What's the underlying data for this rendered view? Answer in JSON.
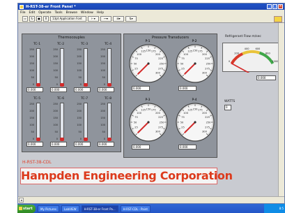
{
  "window": {
    "title": "H-RST-38-er Front Panel *",
    "menu": [
      "File",
      "Edit",
      "Operate",
      "Tools",
      "Browse",
      "Window",
      "Help"
    ],
    "toolbar": {
      "font_select": "13pt Application Font"
    }
  },
  "thermocouples": {
    "title": "Thermocouples",
    "scale": [
      "250",
      "200",
      "150",
      "100",
      "50",
      "0"
    ],
    "items": [
      {
        "label": "TC-1",
        "value": "0.000",
        "level": 0.0
      },
      {
        "label": "TC-2",
        "value": "0.000",
        "level": 0.0
      },
      {
        "label": "TC-3",
        "value": "0.000",
        "level": 0.0
      },
      {
        "label": "TC-4",
        "value": "0.000",
        "level": 0.0
      },
      {
        "label": "TC-5",
        "value": "0.000",
        "level": 0.0
      },
      {
        "label": "TC-6",
        "value": "0.000",
        "level": 0.0
      },
      {
        "label": "TC-7",
        "value": "0.000",
        "level": 0.0
      },
      {
        "label": "TC-8",
        "value": "0.000",
        "level": 0.0
      }
    ]
  },
  "pressure": {
    "title": "Pressure Transducers",
    "scale": [
      "0",
      "25",
      "50",
      "75",
      "100",
      "125",
      "150",
      "175",
      "200",
      "225",
      "250",
      "275",
      "300"
    ],
    "items": [
      {
        "label": "P-1",
        "value": "0.000",
        "reading": 0
      },
      {
        "label": "P-2",
        "value": "0.000",
        "reading": 0
      },
      {
        "label": "P-3",
        "value": "0.000",
        "reading": 0
      },
      {
        "label": "P-4",
        "value": "0.000",
        "reading": 0
      }
    ]
  },
  "refrigerant": {
    "label": "Refrigerant Flow m/sec",
    "scale": [
      "0",
      "200",
      "400",
      "600",
      "800",
      "1000"
    ],
    "value": "0.000",
    "reading": 0
  },
  "watts": {
    "label": "WATTS",
    "value": "0"
  },
  "model_label": "H-RST-38-CDL",
  "banner": "Hampden Engineering Corporation",
  "taskbar": {
    "start": "start",
    "tasks": [
      "My Pictures",
      "LabVIEW",
      "H-RST-38-er Front Pa...",
      "H-RST-CDL - Paint"
    ],
    "clock": "8:5"
  },
  "colors": {
    "accent_red": "#dc3a1c",
    "fill_blue": "#3a67c9",
    "needle_red": "#d42a2a"
  }
}
